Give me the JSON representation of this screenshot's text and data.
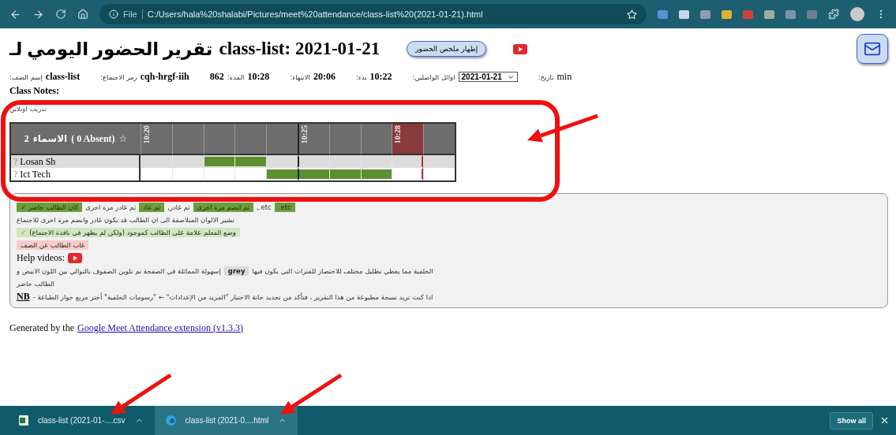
{
  "browser": {
    "scheme": "File",
    "url": "C:/Users/hala%20shalabi/Pictures/meet%20attendance/class-list%20(2021-01-21).html"
  },
  "title": {
    "arabic": "تقرير الحضور اليومي لـ",
    "latin": "class-list: 2021-01-21"
  },
  "summary_button": "إظهار ملخص الحضور",
  "meta": [
    [
      {
        "kind": "plain",
        "text": "min"
      },
      {
        "kind": "label",
        "text": "تاريخ:"
      }
    ],
    [
      {
        "kind": "select",
        "text": "2021-01-21"
      },
      {
        "kind": "label",
        "text": "اوائل الواصلين:"
      }
    ],
    [
      {
        "kind": "value",
        "text": "10:22"
      },
      {
        "kind": "label",
        "text": "بدء:"
      }
    ],
    [
      {
        "kind": "value",
        "text": "20:06"
      },
      {
        "kind": "label",
        "text": "الانتهاء:"
      }
    ],
    [
      {
        "kind": "value",
        "text": "10:28"
      },
      {
        "kind": "label",
        "text": "المدة:"
      },
      {
        "kind": "value",
        "text": "862"
      }
    ],
    [
      {
        "kind": "value",
        "text": "cqh-hrgf-iih"
      },
      {
        "kind": "label",
        "text": "رمز الاجتماع:"
      }
    ],
    [
      {
        "kind": "value",
        "text": "class-list"
      },
      {
        "kind": "label",
        "text": "إسم الصف:"
      }
    ]
  ],
  "notes": {
    "heading": "Class Notes:",
    "text": "تدريب اونلاين"
  },
  "table": {
    "header": {
      "count": "2",
      "label": "الاسماء",
      "absent": "( 0 Absent)",
      "star": "☆"
    },
    "columns": [
      {
        "label": "10:20",
        "current": false
      },
      {
        "current": false
      },
      {
        "current": false
      },
      {
        "current": false
      },
      {
        "current": false
      },
      {
        "label": "10:25",
        "current": false
      },
      {
        "current": false
      },
      {
        "current": false
      },
      {
        "label": "10:28",
        "current": true
      },
      {
        "current": false
      }
    ],
    "rows": [
      {
        "mark": "?",
        "name": "Losan Sh",
        "present": [
          false,
          false,
          true,
          true,
          false,
          false,
          false,
          false,
          false,
          false
        ]
      },
      {
        "mark": "?",
        "name": "Ict Tech",
        "present": [
          false,
          false,
          false,
          false,
          true,
          true,
          true,
          true,
          false,
          false
        ]
      }
    ]
  },
  "legend": [
    [
      {
        "kind": "chip",
        "text": "etc."
      },
      {
        "kind": "plain",
        "text": "etc.,"
      },
      {
        "kind": "chip",
        "text": "ثم انضم مرة اخرى"
      },
      {
        "kind": "plain",
        "text": "ثم غادر,"
      },
      {
        "kind": "chip",
        "text": "ثم عاد"
      },
      {
        "kind": "plain",
        "text": "ثم غادر مرة اخرى"
      },
      {
        "kind": "chip",
        "text": "كان الطالب حاضر ✓"
      }
    ],
    [
      {
        "kind": "plain",
        "text": "تشير الالوان المتلاصقة الى ان الطالب قد يكون غادر وانضم مرة اخرى للاجتماع"
      }
    ],
    [
      {
        "kind": "manual",
        "text": "وضع المعلم علامة على الطالب كموجود (ولكن لم يظهر في نافذة الاجتماع)",
        "check": "✓"
      }
    ],
    [
      {
        "kind": "absent",
        "text": "غاب الطالب عن الصف"
      }
    ],
    [
      {
        "kind": "latin",
        "text": "Help videos:"
      },
      {
        "kind": "video"
      }
    ],
    [
      {
        "kind": "plain",
        "text": "الخلفية مما يعطي تظليل مختلف للاختصار للفترات التي يكون فيها"
      },
      {
        "kind": "grey",
        "text": "grey"
      },
      {
        "kind": "plain",
        "text": "إسهولة المماثلة في الصفحة تم تلوين الصفوف بالتوالي بين اللون الابيض و"
      }
    ],
    [
      {
        "kind": "plain",
        "text": "الطالب حاضر"
      }
    ],
    [
      {
        "kind": "plain",
        "text": "اذا كنت تريد نسخة مطبوعة من هذا التقرير ، فتأكد من تحديد خانة الاختيار \"المزيد من الإعدادات\" ← \"رسومات الخلفية\" أختر مربع حوار الطباعة -"
      },
      {
        "kind": "nb",
        "text": "NB"
      }
    ]
  ],
  "footer": {
    "text": "Generated by the",
    "link": "Google Meet Attendance extension (v1.3.3)"
  },
  "download_bar": {
    "spreadsheet_item": {
      "kind": "sheet",
      "label": "class-list (2021-01-....csv",
      "selected": false
    },
    "page_item": {
      "kind": "browser",
      "label": "class-list (2021-0....html",
      "selected": true
    }
  },
  "show_all": "Show all"
}
